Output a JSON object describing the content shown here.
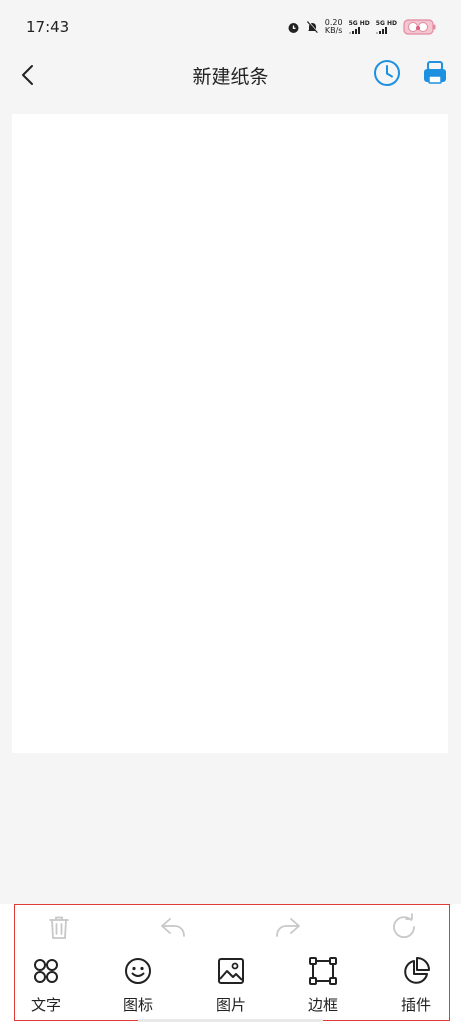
{
  "status_bar": {
    "time": "17:43",
    "net_speed_value": "0.20",
    "net_speed_unit": "KB/s",
    "sim1_label": "5G HD",
    "sim2_label": "5G HD"
  },
  "header": {
    "title": "新建纸条",
    "accent_color": "#1e90e0"
  },
  "actions": {
    "delete": "trash-icon",
    "undo": "undo-icon",
    "redo": "redo-icon",
    "rotate": "rotate-icon"
  },
  "tools": [
    {
      "label": "文字",
      "icon": "text-grid-icon"
    },
    {
      "label": "图标",
      "icon": "smiley-icon"
    },
    {
      "label": "图片",
      "icon": "image-icon"
    },
    {
      "label": "边框",
      "icon": "border-icon"
    },
    {
      "label": "插件",
      "icon": "pie-icon"
    }
  ]
}
